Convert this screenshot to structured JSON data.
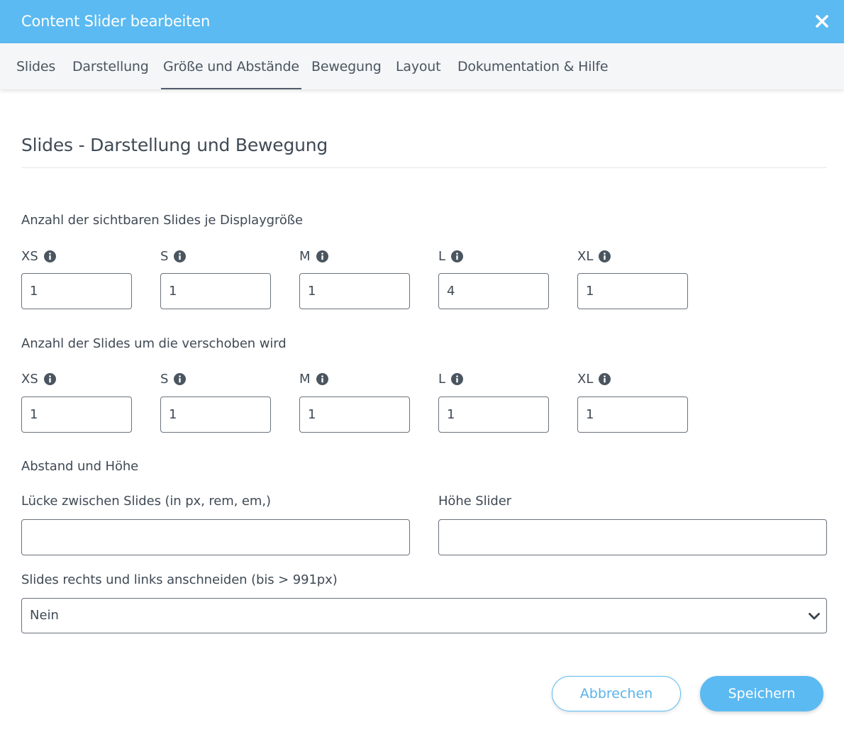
{
  "dialog": {
    "title": "Content Slider bearbeiten",
    "close_icon": "close-icon"
  },
  "tabs": [
    {
      "label": "Slides",
      "active": false
    },
    {
      "label": "Darstellung",
      "active": false
    },
    {
      "label": "Größe und Abstände",
      "active": true
    },
    {
      "label": "Bewegung",
      "active": false
    },
    {
      "label": "Layout",
      "active": false
    },
    {
      "label": "Dokumentation & Hilfe",
      "active": false
    }
  ],
  "section": {
    "title": "Slides - Darstellung und Bewegung"
  },
  "visible_slides": {
    "label": "Anzahl der sichtbaren Slides je Displaygröße",
    "fields": [
      {
        "label": "XS",
        "value": "1"
      },
      {
        "label": "S",
        "value": "1"
      },
      {
        "label": "M",
        "value": "1"
      },
      {
        "label": "L",
        "value": "4"
      },
      {
        "label": "XL",
        "value": "1"
      }
    ]
  },
  "scroll_slides": {
    "label": "Anzahl der Slides um die verschoben wird",
    "fields": [
      {
        "label": "XS",
        "value": "1"
      },
      {
        "label": "S",
        "value": "1"
      },
      {
        "label": "M",
        "value": "1"
      },
      {
        "label": "L",
        "value": "1"
      },
      {
        "label": "XL",
        "value": "1"
      }
    ]
  },
  "spacing": {
    "label": "Abstand und Höhe",
    "gap": {
      "label": "Lücke zwischen Slides (in px, rem, em,)",
      "value": ""
    },
    "height": {
      "label": "Höhe Slider",
      "value": ""
    }
  },
  "crop": {
    "label": "Slides rechts und links anschneiden (bis > 991px)",
    "selected": "Nein"
  },
  "buttons": {
    "cancel": "Abbrechen",
    "save": "Speichern"
  },
  "colors": {
    "accent": "#5bbaf2",
    "text": "#3f4a55",
    "tab_bar": "#f4f6f8"
  }
}
